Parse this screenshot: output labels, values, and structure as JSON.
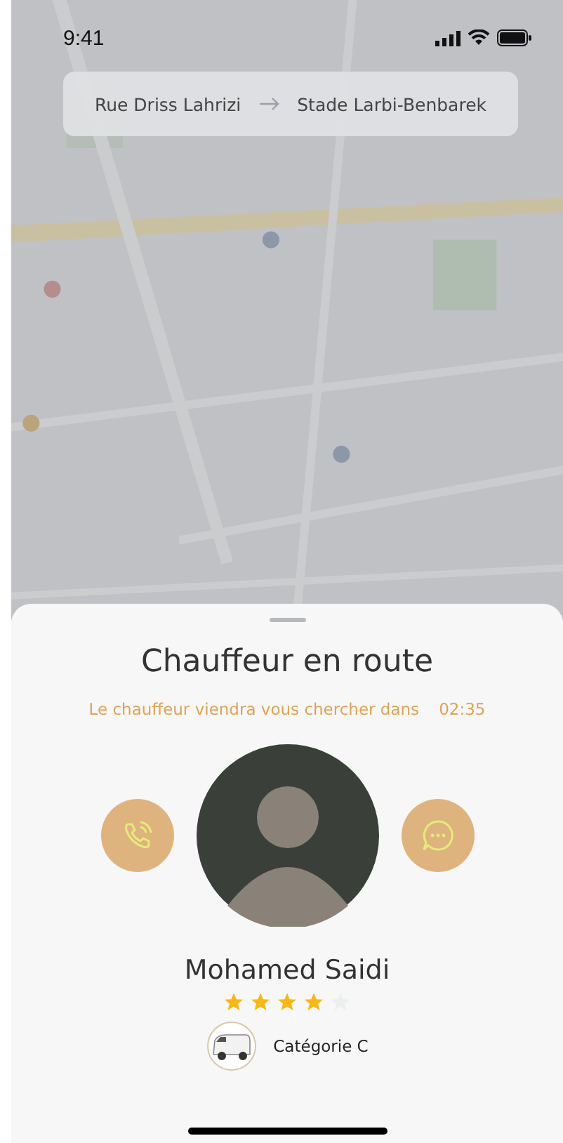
{
  "status_bar": {
    "time": "9:41"
  },
  "route": {
    "from": "Rue Driss Lahrizi",
    "to": "Stade Larbi-Benbarek"
  },
  "sheet": {
    "title": "Chauffeur en route",
    "eta_label": "Le chauffeur viendra vous chercher dans",
    "eta_time": "02:35",
    "driver": {
      "name": "Mohamed Saidi",
      "stars": 4,
      "category": "Catégorie C"
    }
  }
}
